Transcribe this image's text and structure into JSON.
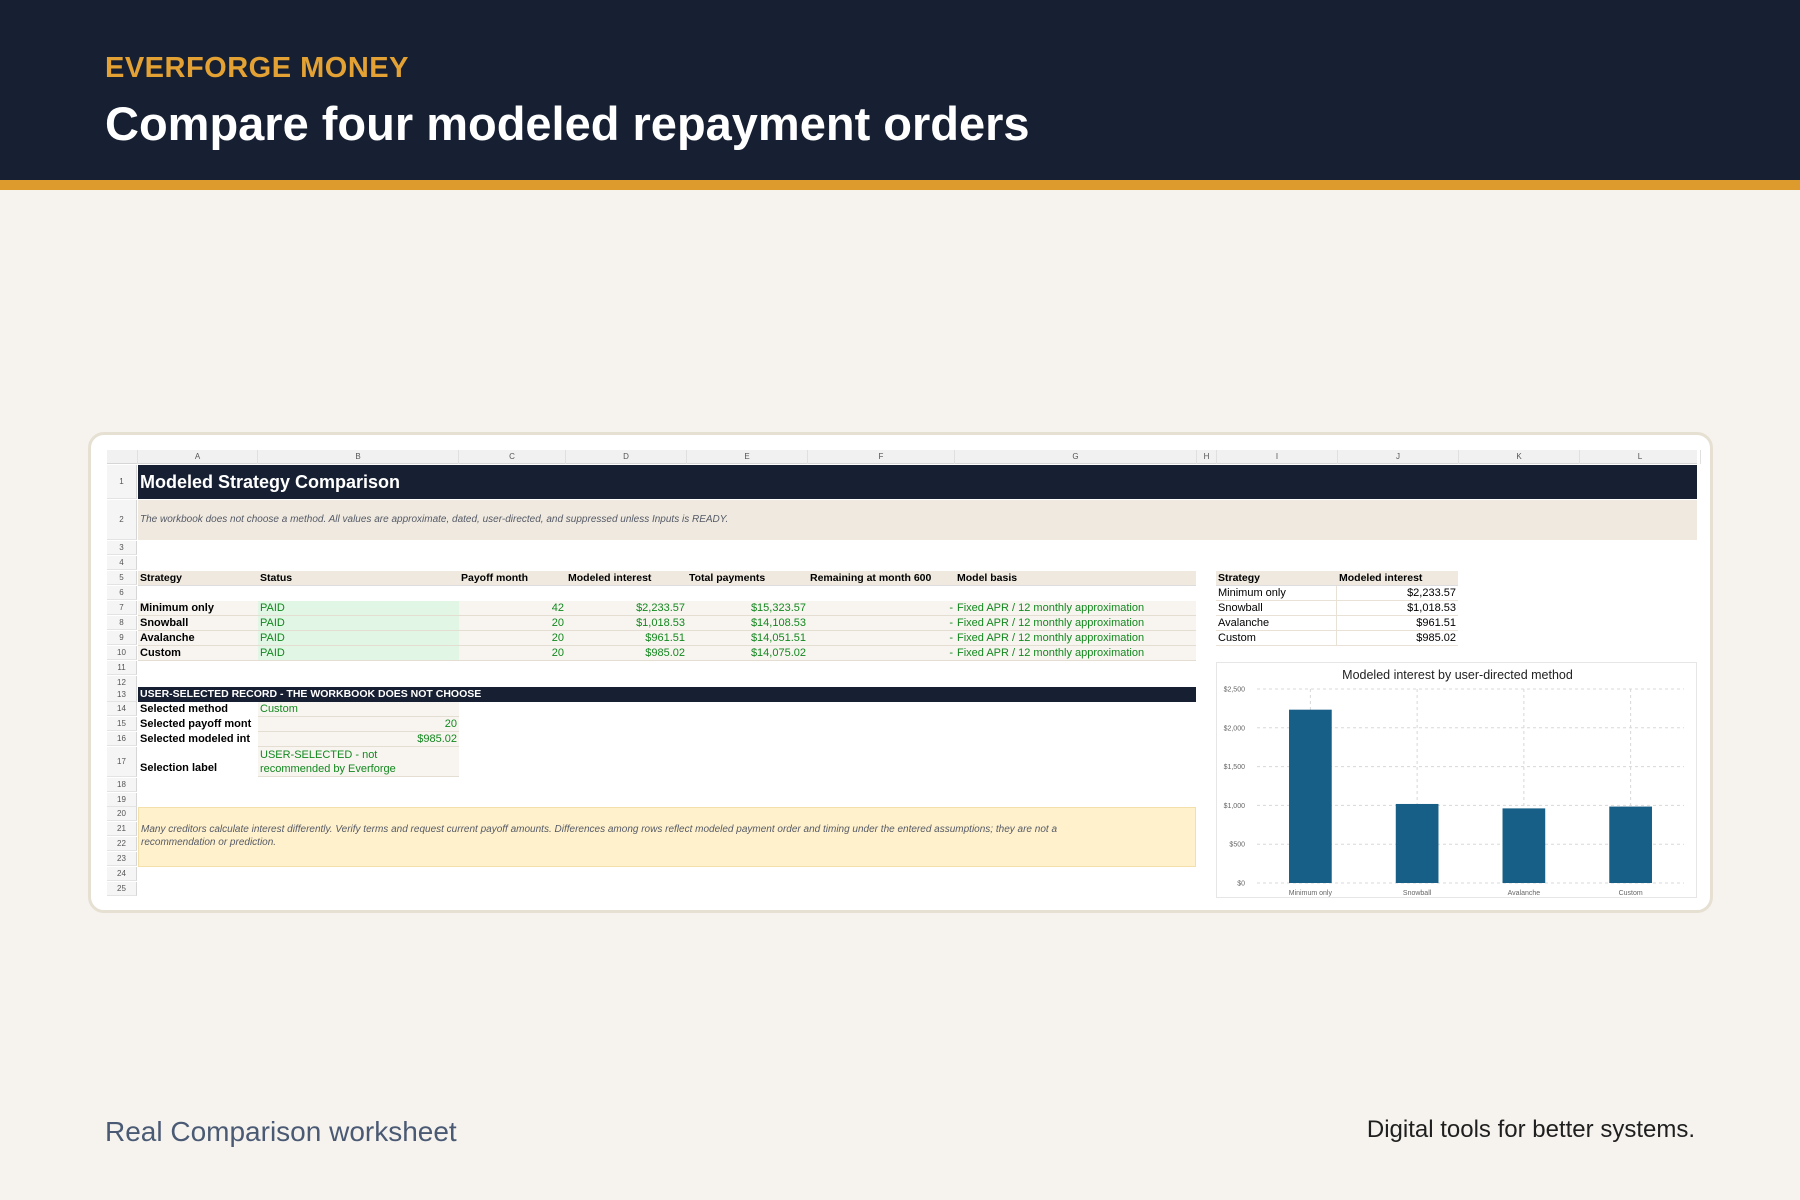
{
  "header": {
    "brand": "EVERFORGE MONEY",
    "headline": "Compare four modeled repayment orders"
  },
  "footer": {
    "left": "Real Comparison worksheet",
    "right": "Digital tools for better systems."
  },
  "sheet": {
    "columns": [
      "A",
      "B",
      "C",
      "D",
      "E",
      "F",
      "G",
      "H",
      "I",
      "J",
      "K",
      "L"
    ],
    "rows": [
      "1",
      "2",
      "3",
      "4",
      "5",
      "6",
      "7",
      "8",
      "9",
      "10",
      "11",
      "12",
      "13",
      "14",
      "15",
      "16",
      "17",
      "18",
      "19",
      "20",
      "21",
      "22",
      "23",
      "24",
      "25"
    ],
    "title": "Modeled Strategy Comparison",
    "note": "The workbook does not choose a method. All values are approximate, dated, user-directed, and suppressed unless Inputs is READY.",
    "table_headers": [
      "Strategy",
      "Status",
      "Payoff month",
      "Modeled interest",
      "Total payments",
      "Remaining at month 600",
      "Model basis"
    ],
    "table_rows": [
      {
        "strategy": "Minimum only",
        "status": "PAID",
        "payoff_month": "42",
        "interest": "$2,233.57",
        "total": "$15,323.57",
        "remaining": "-",
        "basis": "Fixed APR / 12 monthly approximation"
      },
      {
        "strategy": "Snowball",
        "status": "PAID",
        "payoff_month": "20",
        "interest": "$1,018.53",
        "total": "$14,108.53",
        "remaining": "-",
        "basis": "Fixed APR / 12 monthly approximation"
      },
      {
        "strategy": "Avalanche",
        "status": "PAID",
        "payoff_month": "20",
        "interest": "$961.51",
        "total": "$14,051.51",
        "remaining": "-",
        "basis": "Fixed APR / 12 monthly approximation"
      },
      {
        "strategy": "Custom",
        "status": "PAID",
        "payoff_month": "20",
        "interest": "$985.02",
        "total": "$14,075.02",
        "remaining": "-",
        "basis": "Fixed APR / 12 monthly approximation"
      }
    ],
    "selected_section_title": "USER-SELECTED RECORD - THE WORKBOOK DOES NOT CHOOSE",
    "selected": {
      "method_label": "Selected method",
      "method_value": "Custom",
      "payoff_label": "Selected payoff mont",
      "payoff_value": "20",
      "interest_label": "Selected modeled int",
      "interest_value": "$985.02",
      "selection_label": "Selection label",
      "selection_value_line1": "USER-SELECTED - not",
      "selection_value_line2": "recommended by Everforge"
    },
    "disclaimer_line1": "Many creditors calculate interest differently. Verify terms and request current payoff amounts. Differences among rows reflect modeled payment order and timing under the entered assumptions; they are not a",
    "disclaimer_line2": "recommendation or prediction.",
    "summary_headers": [
      "Strategy",
      "Modeled interest"
    ],
    "summary_rows": [
      {
        "strategy": "Minimum only",
        "interest": "$2,233.57"
      },
      {
        "strategy": "Snowball",
        "interest": "$1,018.53"
      },
      {
        "strategy": "Avalanche",
        "interest": "$961.51"
      },
      {
        "strategy": "Custom",
        "interest": "$985.02"
      }
    ]
  },
  "chart_data": {
    "type": "bar",
    "title": "Modeled interest by user-directed method",
    "categories": [
      "Minimum only",
      "Snowball",
      "Avalanche",
      "Custom"
    ],
    "values": [
      2233.57,
      1018.53,
      961.51,
      985.02
    ],
    "ylim": [
      0,
      2500
    ],
    "yticks": [
      0,
      500,
      1000,
      1500,
      2000,
      2500
    ],
    "ytick_labels": [
      "$0",
      "$500",
      "$1,000",
      "$1,500",
      "$2,000",
      "$2,500"
    ],
    "xlabel": "",
    "ylabel": "",
    "grid": true,
    "bar_color": "#175f86"
  }
}
